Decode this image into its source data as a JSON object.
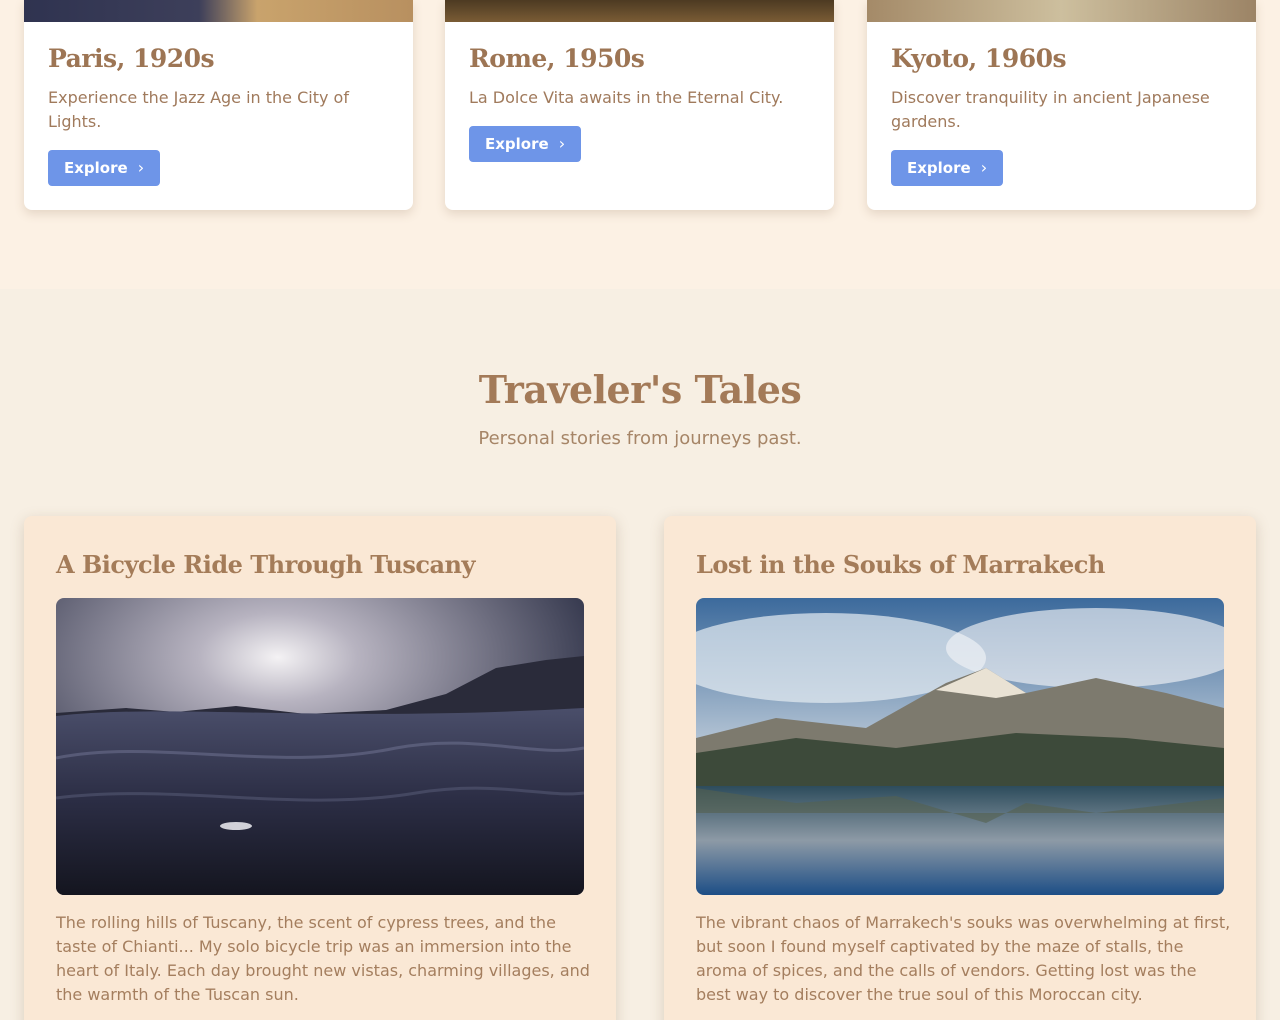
{
  "destinations": [
    {
      "title": "Paris, 1920s",
      "description": "Experience the Jazz Age in the City of Lights.",
      "button": "Explore"
    },
    {
      "title": "Rome, 1950s",
      "description": "La Dolce Vita awaits in the Eternal City.",
      "button": "Explore"
    },
    {
      "title": "Kyoto, 1960s",
      "description": "Discover tranquility in ancient Japanese gardens.",
      "button": "Explore"
    }
  ],
  "tales": {
    "heading": "Traveler's Tales",
    "subheading": "Personal stories from journeys past.",
    "stories": [
      {
        "title": "A Bicycle Ride Through Tuscany",
        "text": "The rolling hills of Tuscany, the scent of cypress trees, and the taste of Chianti... My solo bicycle trip was an immersion into the heart of Italy. Each day brought new vistas, charming villages, and the warmth of the Tuscan sun."
      },
      {
        "title": "Lost in the Souks of Marrakech",
        "text": "The vibrant chaos of Marrakech's souks was overwhelming at first, but soon I found myself captivated by the maze of stalls, the aroma of spices, and the calls of vendors. Getting lost was the best way to discover the true soul of this Moroccan city."
      }
    ]
  },
  "colors": {
    "accent": "#6e95e8",
    "heading": "#a37a58",
    "background": "#fcf1e4",
    "tales_background": "#f7efe3"
  },
  "icons": {
    "explore": "chevron-right-icon"
  }
}
